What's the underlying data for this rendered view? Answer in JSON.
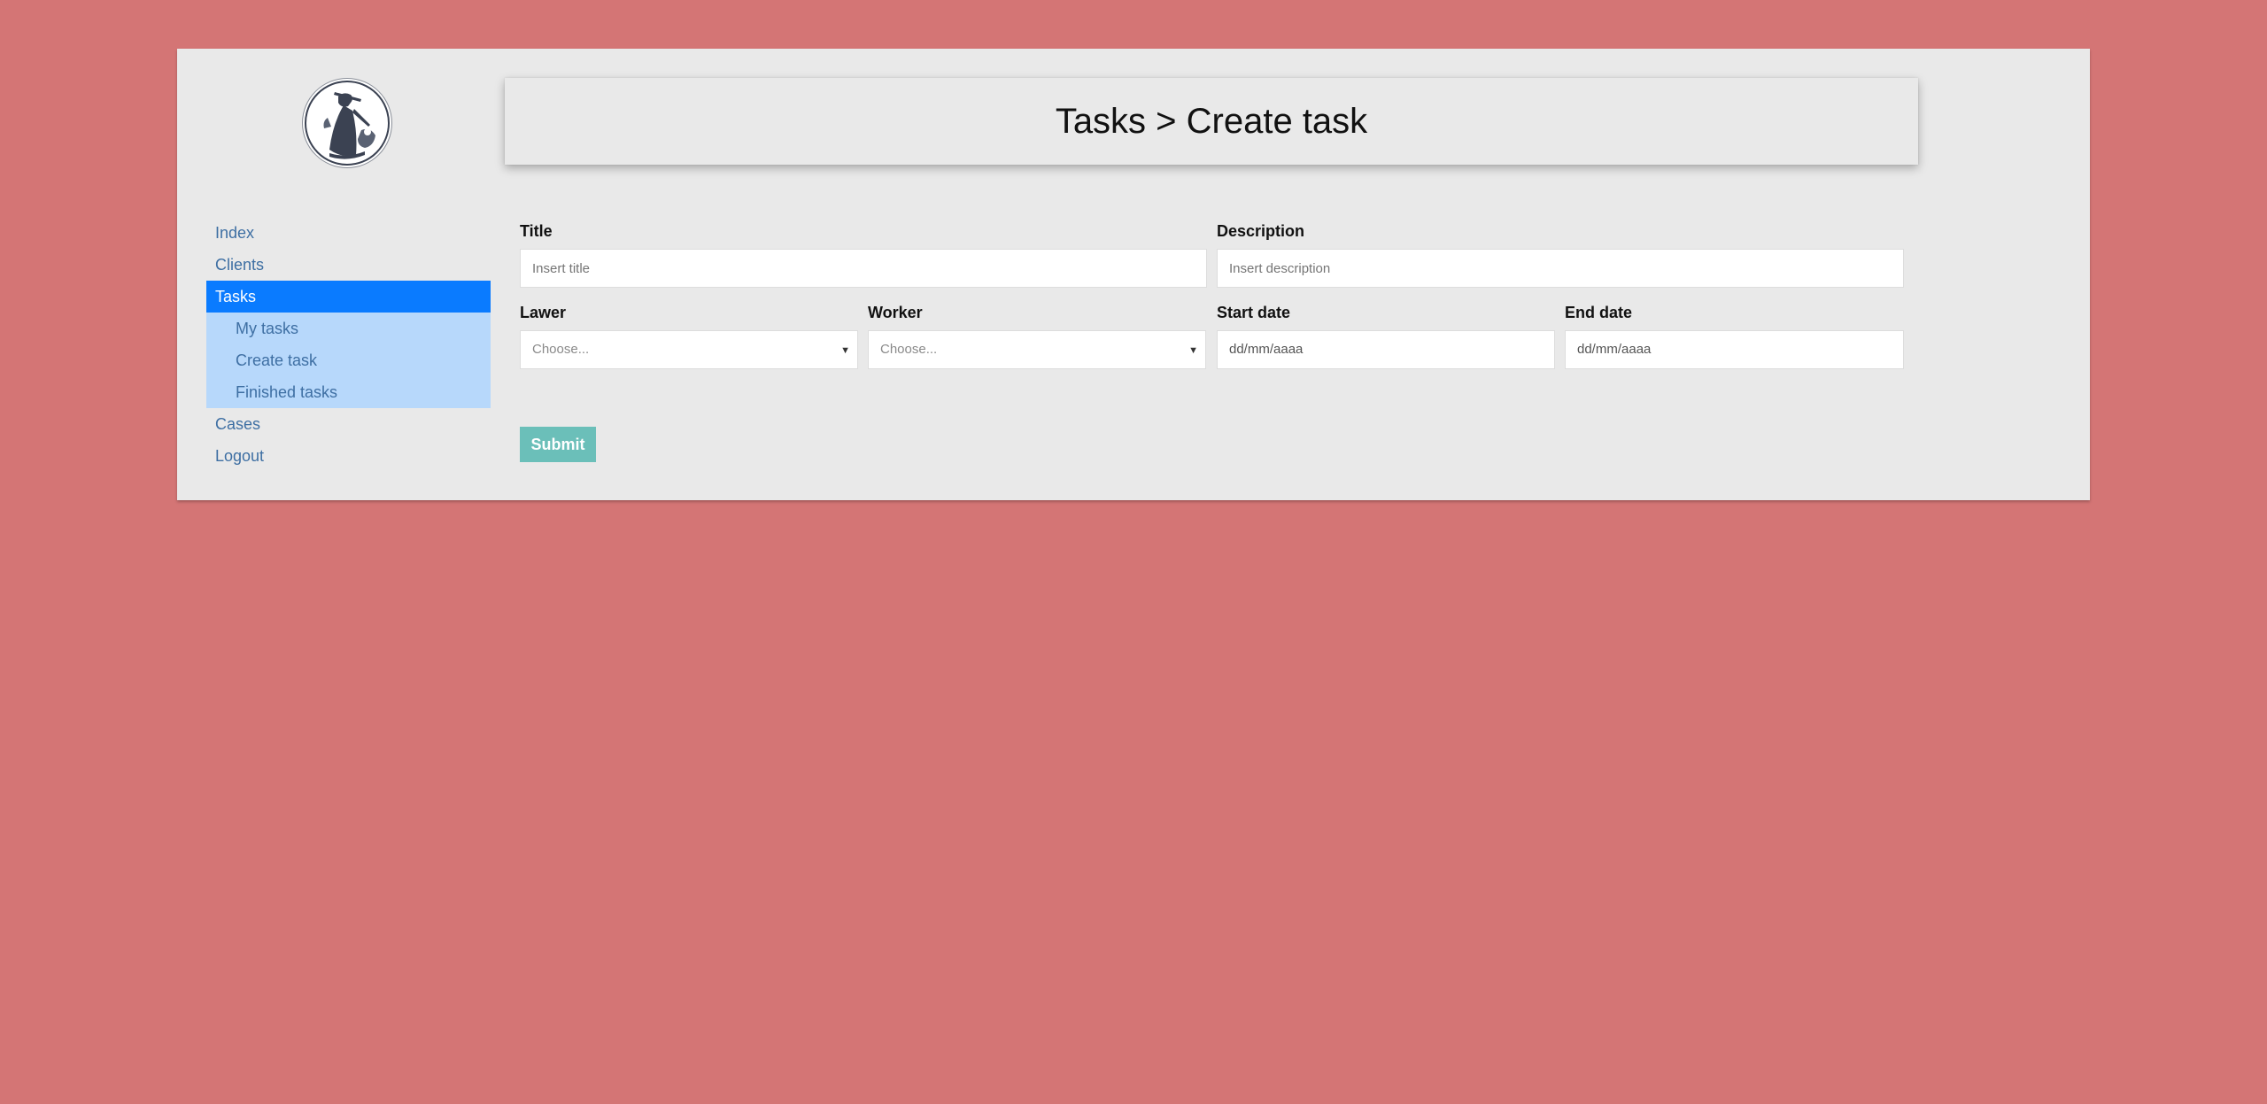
{
  "header": {
    "title": "Tasks > Create task"
  },
  "sidebar": {
    "items": [
      {
        "label": "Index"
      },
      {
        "label": "Clients"
      },
      {
        "label": "Tasks"
      },
      {
        "label": "Cases"
      },
      {
        "label": "Logout"
      }
    ],
    "subitems": [
      {
        "label": "My tasks"
      },
      {
        "label": "Create task"
      },
      {
        "label": "Finished tasks"
      }
    ]
  },
  "form": {
    "title": {
      "label": "Title",
      "placeholder": "Insert title"
    },
    "description": {
      "label": "Description",
      "placeholder": "Insert description"
    },
    "lawer": {
      "label": "Lawer",
      "selected": "Choose..."
    },
    "worker": {
      "label": "Worker",
      "selected": "Choose..."
    },
    "start_date": {
      "label": "Start date",
      "value": "dd/mm/aaaa"
    },
    "end_date": {
      "label": "End date",
      "value": "dd/mm/aaaa"
    },
    "submit_label": "Submit"
  },
  "colors": {
    "page_background": "#d47575",
    "card_background": "#e9e9e9",
    "nav_active": "#0a7bff",
    "subnav_background": "#b7d8fb",
    "link": "#3e6fa3",
    "submit_button": "#6bbfb9"
  },
  "icons": {
    "logo": "lady-justice-logo",
    "select_arrow": "triangle-down"
  }
}
